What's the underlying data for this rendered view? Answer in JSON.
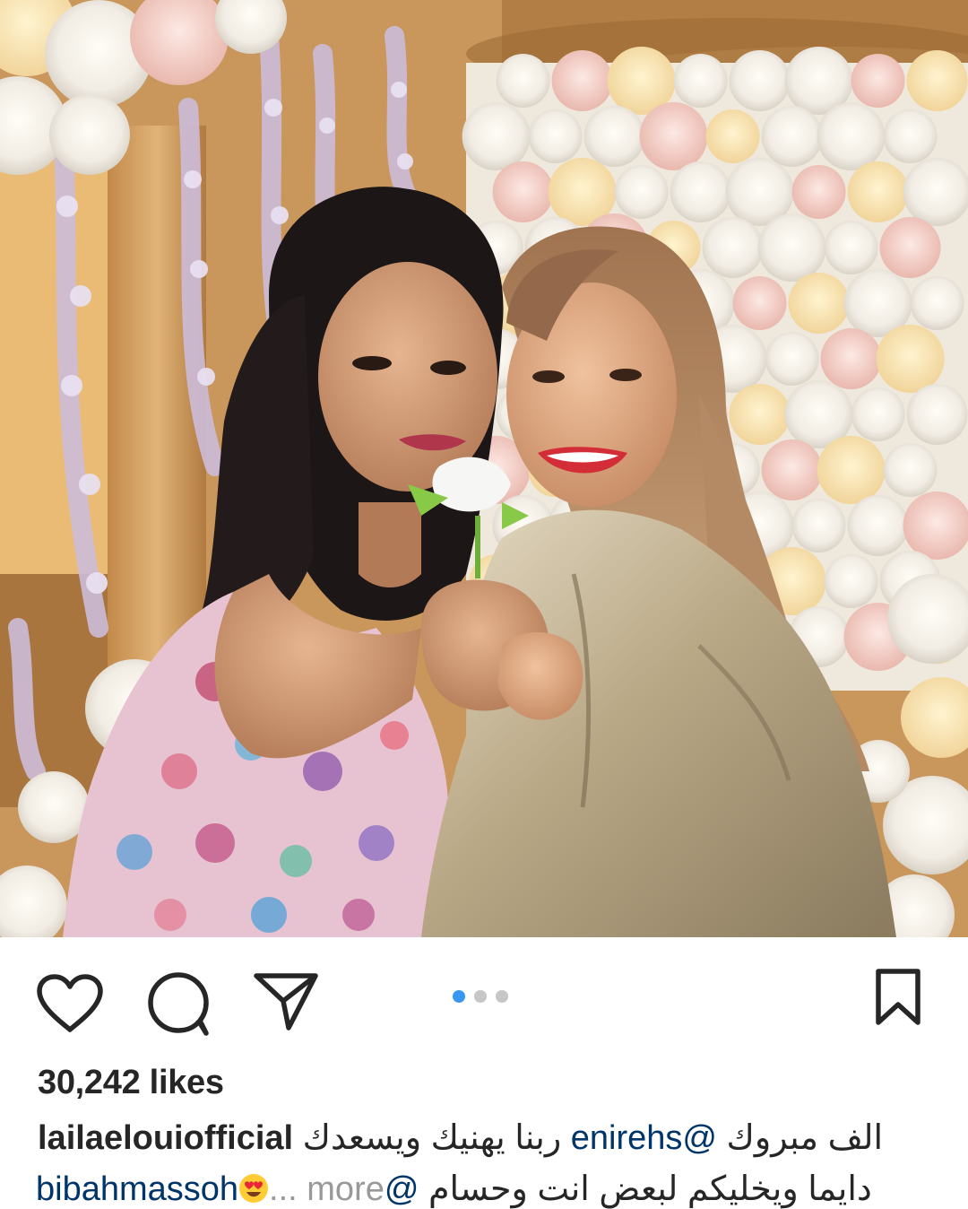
{
  "post": {
    "carousel": {
      "total": 3,
      "active_index": 0
    },
    "likes_text": "30,242 likes",
    "caption": {
      "username": "lailaelouiofficial",
      "line1_arabic": "الف مبروك",
      "mention1": "@enirehs",
      "line1_arabic_2": "ربنا يهنيك ويسعدك",
      "line2_arabic": "دايما ويخليكم لبعض انت وحسام",
      "mention2": "@bibahmassoh",
      "emoji": "heart-eyes-emoji",
      "more_label": "... more"
    }
  },
  "icons": {
    "like": "heart-outline-icon",
    "comment": "comment-bubble-icon",
    "share": "paper-plane-icon",
    "save": "bookmark-outline-icon"
  },
  "colors": {
    "text": "#262626",
    "mention": "#003569",
    "muted": "#999999",
    "dot_active": "#3897f0",
    "dot_inactive": "#c7c7c7"
  }
}
